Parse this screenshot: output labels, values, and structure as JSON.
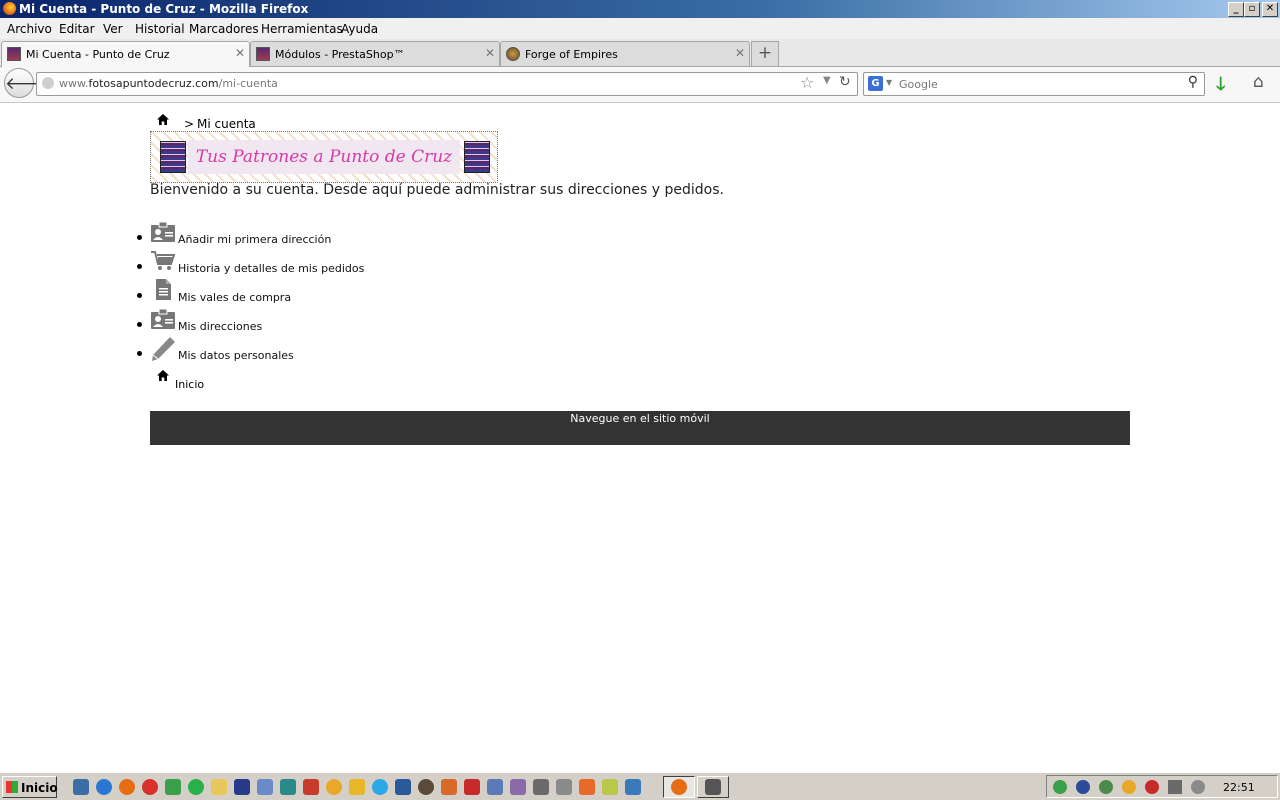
{
  "window": {
    "title": "Mi Cuenta - Punto de Cruz - Mozilla Firefox"
  },
  "menu": [
    "Archivo",
    "Editar",
    "Ver",
    "Historial",
    "Marcadores",
    "Herramientas",
    "Ayuda"
  ],
  "tabs": [
    {
      "label": "Mi Cuenta - Punto de Cruz",
      "active": true
    },
    {
      "label": "Módulos - PrestaShop™",
      "active": false
    },
    {
      "label": "Forge of Empires",
      "active": false
    }
  ],
  "nav": {
    "url_prefix": "www.",
    "url_domain": "fotosapuntodecruz.com",
    "url_path": "/mi-cuenta",
    "search_engine": "G",
    "search_placeholder": "Google"
  },
  "page": {
    "breadcrumb_sep": ">",
    "breadcrumb_current": "Mi cuenta",
    "logo_text": "Tus Patrones a Punto de Cruz",
    "welcome": "Bienvenido a su cuenta. Desde aquí puede administrar sus direcciones y pedidos.",
    "menu_items": [
      {
        "label": "Añadir mi primera dirección",
        "icon": "address-card-icon"
      },
      {
        "label": "Historia y detalles de mis pedidos",
        "icon": "cart-icon"
      },
      {
        "label": "Mis vales de compra",
        "icon": "document-icon"
      },
      {
        "label": "Mis direcciones",
        "icon": "address-card-icon"
      },
      {
        "label": "Mis datos personales",
        "icon": "pencil-icon"
      }
    ],
    "home_link": "Inicio",
    "footer_link": "Navegue en el sitio móvil"
  },
  "taskbar": {
    "start_label": "Inicio",
    "clock": "22:51"
  },
  "colors": {
    "footer_bg": "#333333",
    "logo_text": "#d838a8",
    "download_arrow": "#2aa02a"
  }
}
